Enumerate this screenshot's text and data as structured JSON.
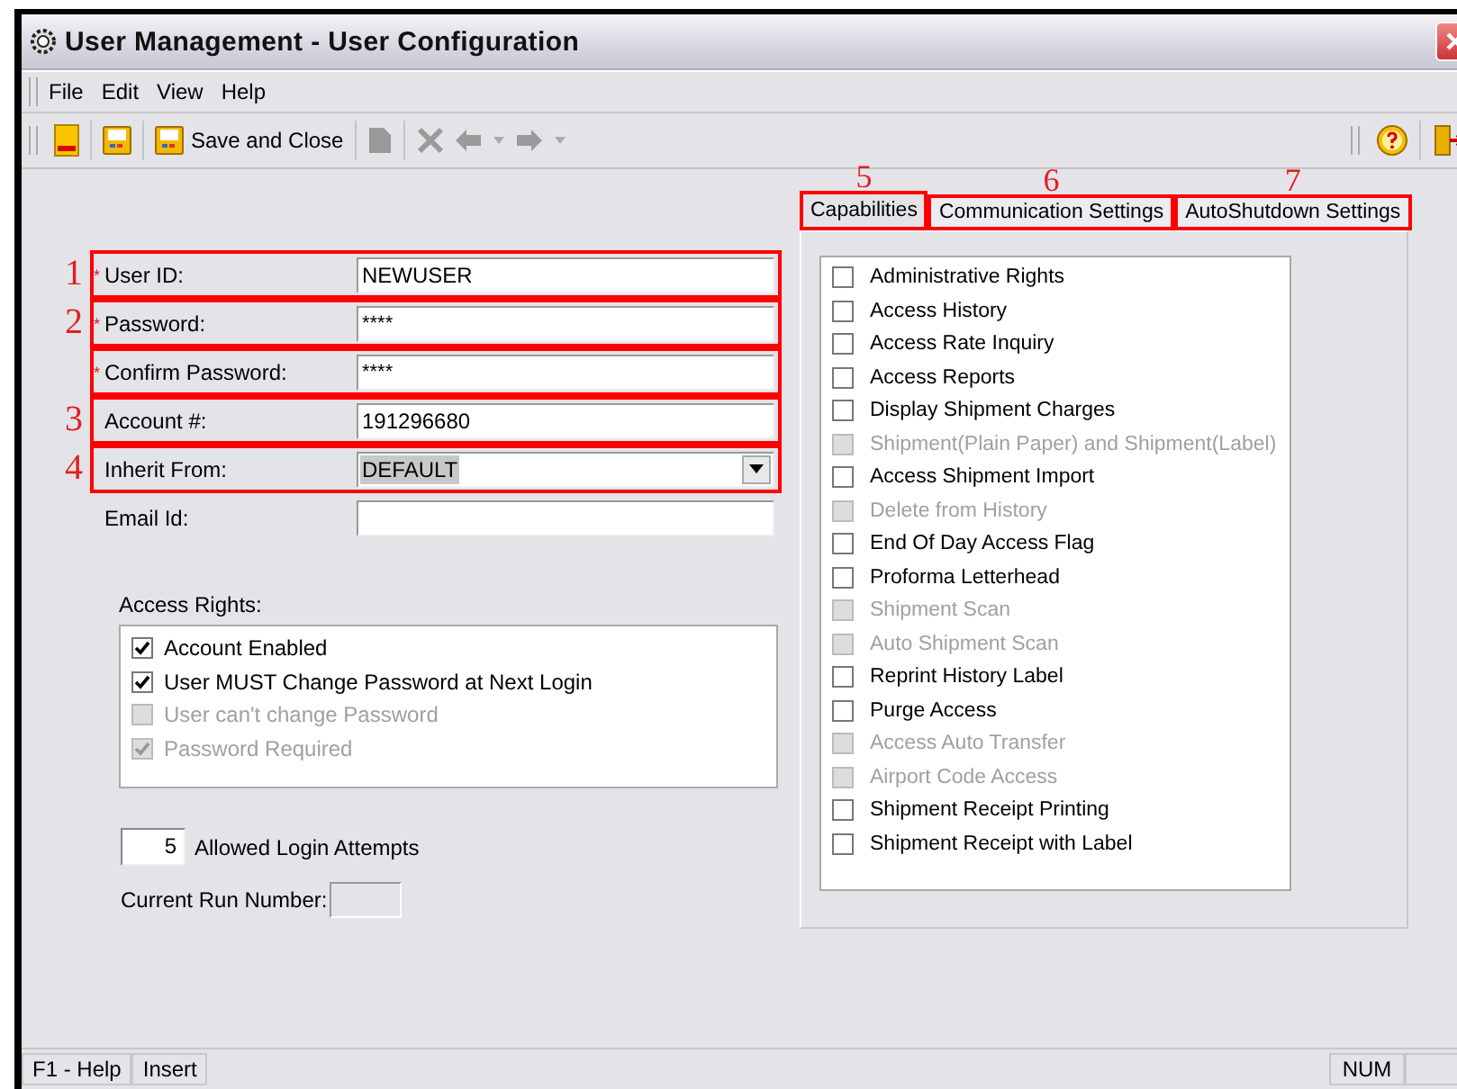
{
  "window": {
    "title": "User Management - User Configuration"
  },
  "menu": [
    "File",
    "Edit",
    "View",
    "Help"
  ],
  "toolbar": {
    "save_close": "Save and Close"
  },
  "form_fields": [
    {
      "label": "User ID:",
      "required_mark": "*",
      "value": "NEWUSER",
      "kind": "text",
      "highlighted": true,
      "annotation": "1"
    },
    {
      "label": "Password:",
      "required_mark": "*",
      "value": "****",
      "kind": "password",
      "highlighted": true,
      "annotation": "2"
    },
    {
      "label": "Confirm Password:",
      "required_mark": "*",
      "value": "****",
      "kind": "password",
      "highlighted": true
    },
    {
      "label": "Account #:",
      "value": "191296680",
      "kind": "text",
      "highlighted": true,
      "annotation": "3"
    },
    {
      "label": "Inherit From:",
      "value": "DEFAULT",
      "kind": "dropdown",
      "highlighted": true,
      "annotation": "4"
    },
    {
      "label": "Email Id:",
      "kind": "text",
      "highlighted": false
    }
  ],
  "access_rights": {
    "label": "Access Rights:",
    "items": [
      {
        "label": "Account Enabled",
        "checked": true,
        "disabled": false
      },
      {
        "label": "User MUST Change Password at Next Login",
        "checked": true,
        "disabled": false
      },
      {
        "label": "User can't change Password",
        "checked": false,
        "disabled": true
      },
      {
        "label": "Password Required",
        "checked": true,
        "disabled": true
      }
    ]
  },
  "login_attempts": {
    "value": "5",
    "label": "Allowed Login Attempts"
  },
  "run_number": {
    "label": "Current Run Number:"
  },
  "tabs": [
    {
      "label": "Capabilities",
      "selected": true,
      "highlighted": true,
      "annotation": "5"
    },
    {
      "label": "Communication Settings",
      "selected": false,
      "highlighted": true,
      "annotation": "6"
    },
    {
      "label": "AutoShutdown Settings",
      "selected": false,
      "highlighted": true,
      "annotation": "7"
    }
  ],
  "capabilities": [
    {
      "label": "Administrative Rights",
      "checked": false,
      "disabled": false
    },
    {
      "label": "Access History",
      "checked": false,
      "disabled": false
    },
    {
      "label": "Access Rate Inquiry",
      "checked": false,
      "disabled": false
    },
    {
      "label": "Access Reports",
      "checked": false,
      "disabled": false
    },
    {
      "label": "Display Shipment Charges",
      "checked": false,
      "disabled": false
    },
    {
      "label": "Shipment(Plain Paper) and Shipment(Label)",
      "checked": false,
      "disabled": true
    },
    {
      "label": "Access Shipment Import",
      "checked": false,
      "disabled": false
    },
    {
      "label": "Delete from History",
      "checked": false,
      "disabled": true
    },
    {
      "label": "End Of Day Access Flag",
      "checked": false,
      "disabled": false
    },
    {
      "label": "Proforma Letterhead",
      "checked": false,
      "disabled": false
    },
    {
      "label": "Shipment Scan",
      "checked": false,
      "disabled": true
    },
    {
      "label": "Auto Shipment Scan",
      "checked": false,
      "disabled": true
    },
    {
      "label": "Reprint History Label",
      "checked": false,
      "disabled": false
    },
    {
      "label": "Purge Access",
      "checked": false,
      "disabled": false
    },
    {
      "label": "Access Auto Transfer",
      "checked": false,
      "disabled": true
    },
    {
      "label": "Airport Code Access",
      "checked": false,
      "disabled": true
    },
    {
      "label": "Shipment Receipt Printing",
      "checked": false,
      "disabled": false
    },
    {
      "label": "Shipment Receipt with Label",
      "checked": false,
      "disabled": false
    }
  ],
  "status_bar": [
    "F1 - Help",
    "Insert",
    "NUM"
  ]
}
